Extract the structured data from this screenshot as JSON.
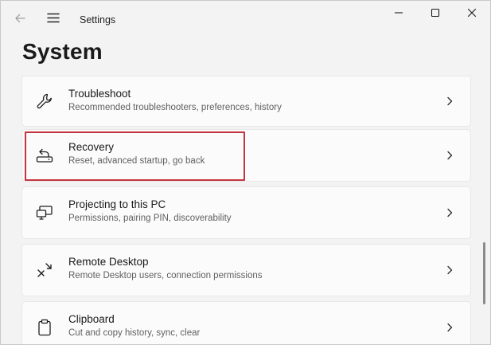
{
  "window": {
    "app_title": "Settings",
    "page_title": "System"
  },
  "titlebar": {
    "back_icon": "arrow-left-icon",
    "menu_icon": "hamburger-menu-icon",
    "minimize_icon": "minimize-icon",
    "maximize_icon": "maximize-icon",
    "close_icon": "close-icon"
  },
  "items": [
    {
      "title": "Troubleshoot",
      "subtitle": "Recommended troubleshooters, preferences, history",
      "icon": "wrench-icon"
    },
    {
      "title": "Recovery",
      "subtitle": "Reset, advanced startup, go back",
      "icon": "recovery-icon",
      "highlighted": true
    },
    {
      "title": "Projecting to this PC",
      "subtitle": "Permissions, pairing PIN, discoverability",
      "icon": "projecting-icon"
    },
    {
      "title": "Remote Desktop",
      "subtitle": "Remote Desktop users, connection permissions",
      "icon": "remote-desktop-icon"
    },
    {
      "title": "Clipboard",
      "subtitle": "Cut and copy history, sync, clear",
      "icon": "clipboard-icon"
    }
  ],
  "colors": {
    "window_bg": "#f3f3f3",
    "card_bg": "#fbfbfb",
    "highlight": "#c4343f"
  }
}
